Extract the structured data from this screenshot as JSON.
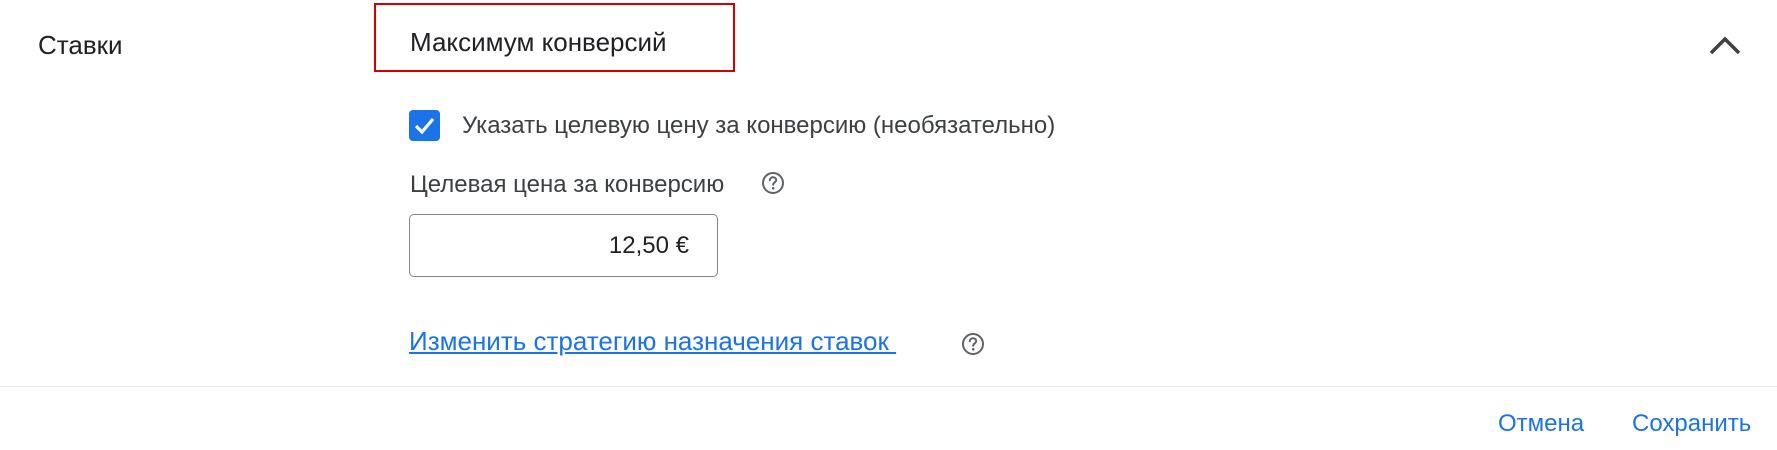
{
  "section": {
    "label": "Ставки"
  },
  "strategy": {
    "title": "Максимум конверсий",
    "highlight_color": "#d50000"
  },
  "collapse": {
    "icon": "chevron-up-icon"
  },
  "target_cpa_checkbox": {
    "checked": true,
    "label": "Указать целевую цену за конверсию (необязательно)"
  },
  "target_cpa_field": {
    "label": "Целевая цена за конверсию",
    "value": "12,50 €",
    "help_icon": "help-circle-icon"
  },
  "change_strategy_link": {
    "label": "Изменить стратегию назначения ставок ",
    "help_icon": "help-circle-icon"
  },
  "actions": {
    "cancel_label": "Отмена",
    "save_label": "Сохранить"
  },
  "colors": {
    "accent": "#1a73e8",
    "text": "#202124",
    "secondary_text": "#3c4043",
    "divider": "#e8eaed"
  }
}
